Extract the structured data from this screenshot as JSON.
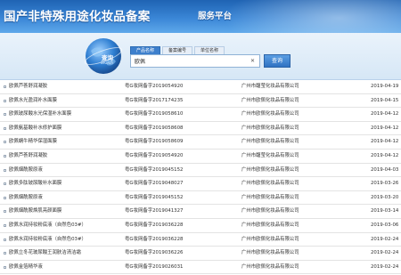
{
  "header": {
    "title": "国产非特殊用途化妆品备案",
    "subtitle": "服务平台"
  },
  "search": {
    "label": "查询",
    "label_en": "Search",
    "tabs": [
      {
        "label": "产品名称",
        "active": true
      },
      {
        "label": "备案编号",
        "active": false
      },
      {
        "label": "单位名称",
        "active": false
      }
    ],
    "value": "欧佩",
    "button_label": "查询"
  },
  "results": [
    {
      "name": "欧佩芦荟舒润凝胶",
      "code": "粤G妆网备字2019054920",
      "company": "广州市馥莹化妆品有限公司",
      "date": "2019-04-19"
    },
    {
      "name": "欧佩水光盈润补水面膜",
      "code": "粤G妆网备字2017174235",
      "company": "广州市欧佩化妆品有限公司",
      "date": "2019-04-15"
    },
    {
      "name": "欧佩玻尿酸水光保湿补水面膜",
      "code": "粤G妆网备字2019058610",
      "company": "广州市欧佩化妆品有限公司",
      "date": "2019-04-12"
    },
    {
      "name": "欧佩氨基酸补水修护面膜",
      "code": "粤G妆网备字2019058608",
      "company": "广州市欧佩化妆品有限公司",
      "date": "2019-04-12"
    },
    {
      "name": "欧佩蜗牛精华保湿面膜",
      "code": "粤G妆网备字2019058609",
      "company": "广州市欧佩化妆品有限公司",
      "date": "2019-04-12"
    },
    {
      "name": "欧佩芦荟舒润凝胶",
      "code": "粤G妆网备字2019054920",
      "company": "广州市馥莹化妆品有限公司",
      "date": "2019-04-12"
    },
    {
      "name": "欧佩烟酰胺原液",
      "code": "粤G妆网备字2019045152",
      "company": "广州市欧佩化妆品有限公司",
      "date": "2019-04-03"
    },
    {
      "name": "欧佩多肽玻尿酸补水面膜",
      "code": "粤G妆网备字2019048027",
      "company": "广州市欧佩化妆品有限公司",
      "date": "2019-03-26"
    },
    {
      "name": "欧佩烟酰胺原液",
      "code": "粤G妆网备字2019045152",
      "company": "广州市欧佩化妆品有限公司",
      "date": "2019-03-20"
    },
    {
      "name": "欧佩烟酰胺焕肌亮颜面膜",
      "code": "粤G妆网备字2019041327",
      "company": "广州市欧佩化妆品有限公司",
      "date": "2019-03-14"
    },
    {
      "name": "欧佩水润持妆粉底液（自然色03#）",
      "code": "粤G妆网备字2019036228",
      "company": "广州市欧佩化妆品有限公司",
      "date": "2019-03-06"
    },
    {
      "name": "欧佩水润持妆粉底液（自然色03#）",
      "code": "粤G妆网备字2019036228",
      "company": "广州市欧佩化妆品有限公司",
      "date": "2019-02-24"
    },
    {
      "name": "欧佩立冬花玻尿酸王润肤洁清洁霜",
      "code": "粤G妆网备字2019036226",
      "company": "广州市欧佩化妆品有限公司",
      "date": "2019-02-24"
    },
    {
      "name": "欧佩金箔精华液",
      "code": "粤G妆网备字2019026031",
      "company": "广州市欧佩化妆品有限公司",
      "date": "2019-02-24"
    }
  ]
}
